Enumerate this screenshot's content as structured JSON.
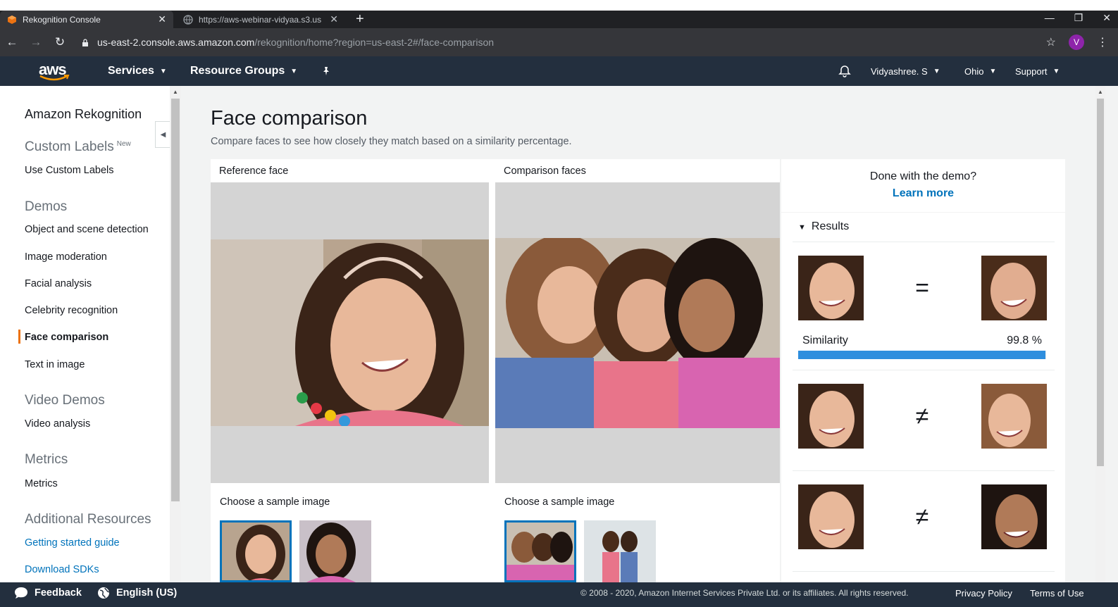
{
  "browser": {
    "tabs": [
      {
        "title": "Rekognition Console",
        "close": "✕"
      },
      {
        "title": "https://aws-webinar-vidyaa.s3.us",
        "close": "✕"
      }
    ],
    "new_tab": "+",
    "window_controls": [
      "—",
      "❐",
      "✕"
    ],
    "url_host": "us-east-2.console.aws.amazon.com",
    "url_path": "/rekognition/home?region=us-east-2#/face-comparison",
    "avatar_letter": "V"
  },
  "aws_nav": {
    "logo": "aws",
    "services": "Services",
    "resource_groups": "Resource Groups",
    "user": "Vidyashree. S",
    "region": "Ohio",
    "support": "Support"
  },
  "sidebar": {
    "title": "Amazon Rekognition",
    "custom_labels": {
      "heading": "Custom Labels",
      "badge": "New",
      "items": [
        "Use Custom Labels"
      ]
    },
    "demos": {
      "heading": "Demos",
      "items": [
        "Object and scene detection",
        "Image moderation",
        "Facial analysis",
        "Celebrity recognition",
        "Face comparison",
        "Text in image"
      ],
      "active": "Face comparison"
    },
    "video_demos": {
      "heading": "Video Demos",
      "items": [
        "Video analysis"
      ]
    },
    "metrics": {
      "heading": "Metrics",
      "items": [
        "Metrics"
      ]
    },
    "additional": {
      "heading": "Additional Resources",
      "items": [
        "Getting started guide",
        "Download SDKs"
      ]
    }
  },
  "main": {
    "title": "Face comparison",
    "subtitle": "Compare faces to see how closely they match based on a similarity percentage.",
    "reference": {
      "label": "Reference face",
      "sample_label": "Choose a sample image"
    },
    "comparison": {
      "label": "Comparison faces",
      "sample_label": "Choose a sample image"
    }
  },
  "results": {
    "done_text": "Done with the demo?",
    "learn_more": "Learn more",
    "heading": "Results",
    "matches": [
      {
        "symbol": "=",
        "similarity_label": "Similarity",
        "similarity": "99.8 %",
        "similarity_fraction": 0.998
      },
      {
        "symbol": "≠"
      },
      {
        "symbol": "≠"
      }
    ]
  },
  "footer": {
    "feedback": "Feedback",
    "language": "English (US)",
    "copyright": "© 2008 - 2020, Amazon Internet Services Private Ltd. or its affiliates. All rights reserved.",
    "privacy": "Privacy Policy",
    "terms": "Terms of Use"
  },
  "colors": {
    "aws_nav": "#232f3e",
    "accent_orange": "#ec7211",
    "link_blue": "#0073bb",
    "bar_blue": "#2e8ede"
  }
}
